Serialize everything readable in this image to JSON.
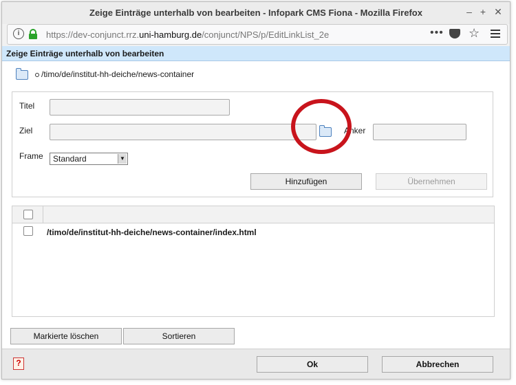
{
  "window": {
    "title": "Zeige Einträge unterhalb von bearbeiten - Infopark CMS Fiona - Mozilla Firefox",
    "controls": {
      "minimize": "–",
      "maximize": "+",
      "close": "✕"
    }
  },
  "urlbar": {
    "info_glyph": "i",
    "url_prefix": "https://dev-conjunct.rrz.",
    "url_domain": "uni-hamburg.de",
    "url_suffix": "/conjunct/NPS/p/EditLinkList_2e",
    "more_glyph": "•••",
    "star_glyph": "☆"
  },
  "page": {
    "header": "Zeige Einträge unterhalb von bearbeiten",
    "path": "/timo/de/institut-hh-deiche/news-container"
  },
  "form": {
    "titel_label": "Titel",
    "titel_value": "",
    "ziel_label": "Ziel",
    "ziel_value": "",
    "anker_label": "Anker",
    "anker_value": "",
    "frame_label": "Frame",
    "frame_selected": "Standard",
    "add_button": "Hinzufügen",
    "apply_button": "Übernehmen"
  },
  "list": {
    "rows": [
      {
        "label": "/timo/de/institut-hh-deiche/news-container/index.html",
        "checked": false
      }
    ]
  },
  "actions": {
    "delete_marked": "Markierte löschen",
    "sort": "Sortieren"
  },
  "footer": {
    "help_glyph": "?",
    "ok": "Ok",
    "cancel": "Abbrechen"
  },
  "colors": {
    "header_bg": "#cfe7fb",
    "annotation_circle": "#c8141c",
    "lock_green": "#2aa32a"
  }
}
